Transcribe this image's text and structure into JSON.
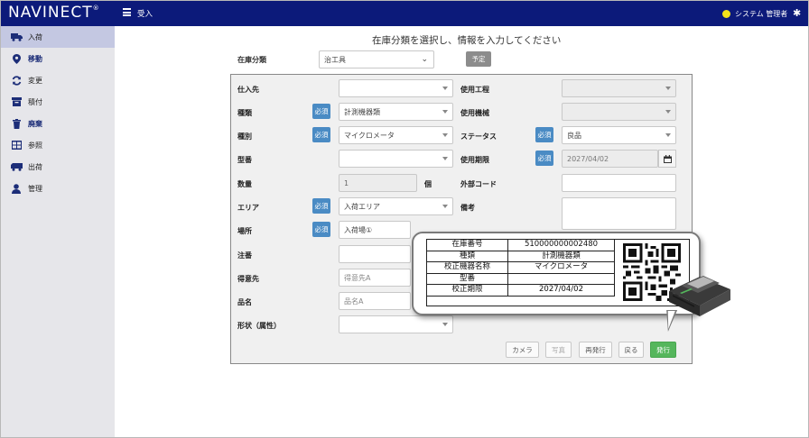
{
  "header": {
    "brand": "NAVINECT",
    "brand_mark": "®",
    "page_name": "受入",
    "user_name": "システム 管理者",
    "icons": [
      "menu-icon",
      "user-status-icon",
      "gear-icon"
    ]
  },
  "sidebar": {
    "items": [
      {
        "label": "入荷",
        "icon": "truck-icon",
        "active": true
      },
      {
        "label": "移動",
        "icon": "map-pin-icon"
      },
      {
        "label": "変更",
        "icon": "refresh-icon"
      },
      {
        "label": "積付",
        "icon": "box-icon"
      },
      {
        "label": "廃棄",
        "icon": "trash-icon"
      },
      {
        "label": "参照",
        "icon": "table-icon"
      },
      {
        "label": "出荷",
        "icon": "truck-out-icon"
      },
      {
        "label": "管理",
        "icon": "user-icon"
      }
    ]
  },
  "main": {
    "title": "在庫分類を選択し、情報を入力してください",
    "category_label": "在庫分類",
    "category_value": "治工具",
    "plan_button": "予定"
  },
  "form": {
    "required": "必須",
    "left": {
      "supplier": {
        "label": "仕入先",
        "value": ""
      },
      "type": {
        "label": "種類",
        "value": "計測機器類"
      },
      "kind": {
        "label": "種別",
        "value": "マイクロメータ"
      },
      "model": {
        "label": "型番",
        "value": ""
      },
      "quantity": {
        "label": "数量",
        "value": "1",
        "unit": "個"
      },
      "area": {
        "label": "エリア",
        "value": "入荷エリア"
      },
      "location": {
        "label": "場所",
        "value": "入荷場①"
      },
      "order_no": {
        "label": "注番",
        "value": ""
      },
      "customer": {
        "label": "得意先",
        "placeholder": "得意先A"
      },
      "product": {
        "label": "品名",
        "placeholder": "品名A"
      },
      "shape": {
        "label": "形状（属性）",
        "value": ""
      }
    },
    "right": {
      "process": {
        "label": "使用工程",
        "value": ""
      },
      "machine": {
        "label": "使用機械",
        "value": ""
      },
      "status": {
        "label": "ステータス",
        "value": "良品"
      },
      "expiry": {
        "label": "使用期限",
        "value": "2027/04/02"
      },
      "ext_code": {
        "label": "外部コード",
        "value": ""
      },
      "remarks": {
        "label": "備考",
        "value": ""
      }
    },
    "actions": {
      "camera": "カメラ",
      "photo": "写真",
      "reissue": "再発行",
      "back": "戻る",
      "issue": "発行"
    }
  },
  "label_preview": {
    "rows": [
      {
        "key": "在庫番号",
        "value": "510000000002480"
      },
      {
        "key": "種類",
        "value": "計測機器類"
      },
      {
        "key": "校正機器名称",
        "value": "マイクロメータ"
      },
      {
        "key": "型番",
        "value": ""
      },
      {
        "key": "校正期限",
        "value": "2027/04/02"
      }
    ],
    "icons": [
      "qr-code-icon",
      "label-printer-icon"
    ]
  }
}
